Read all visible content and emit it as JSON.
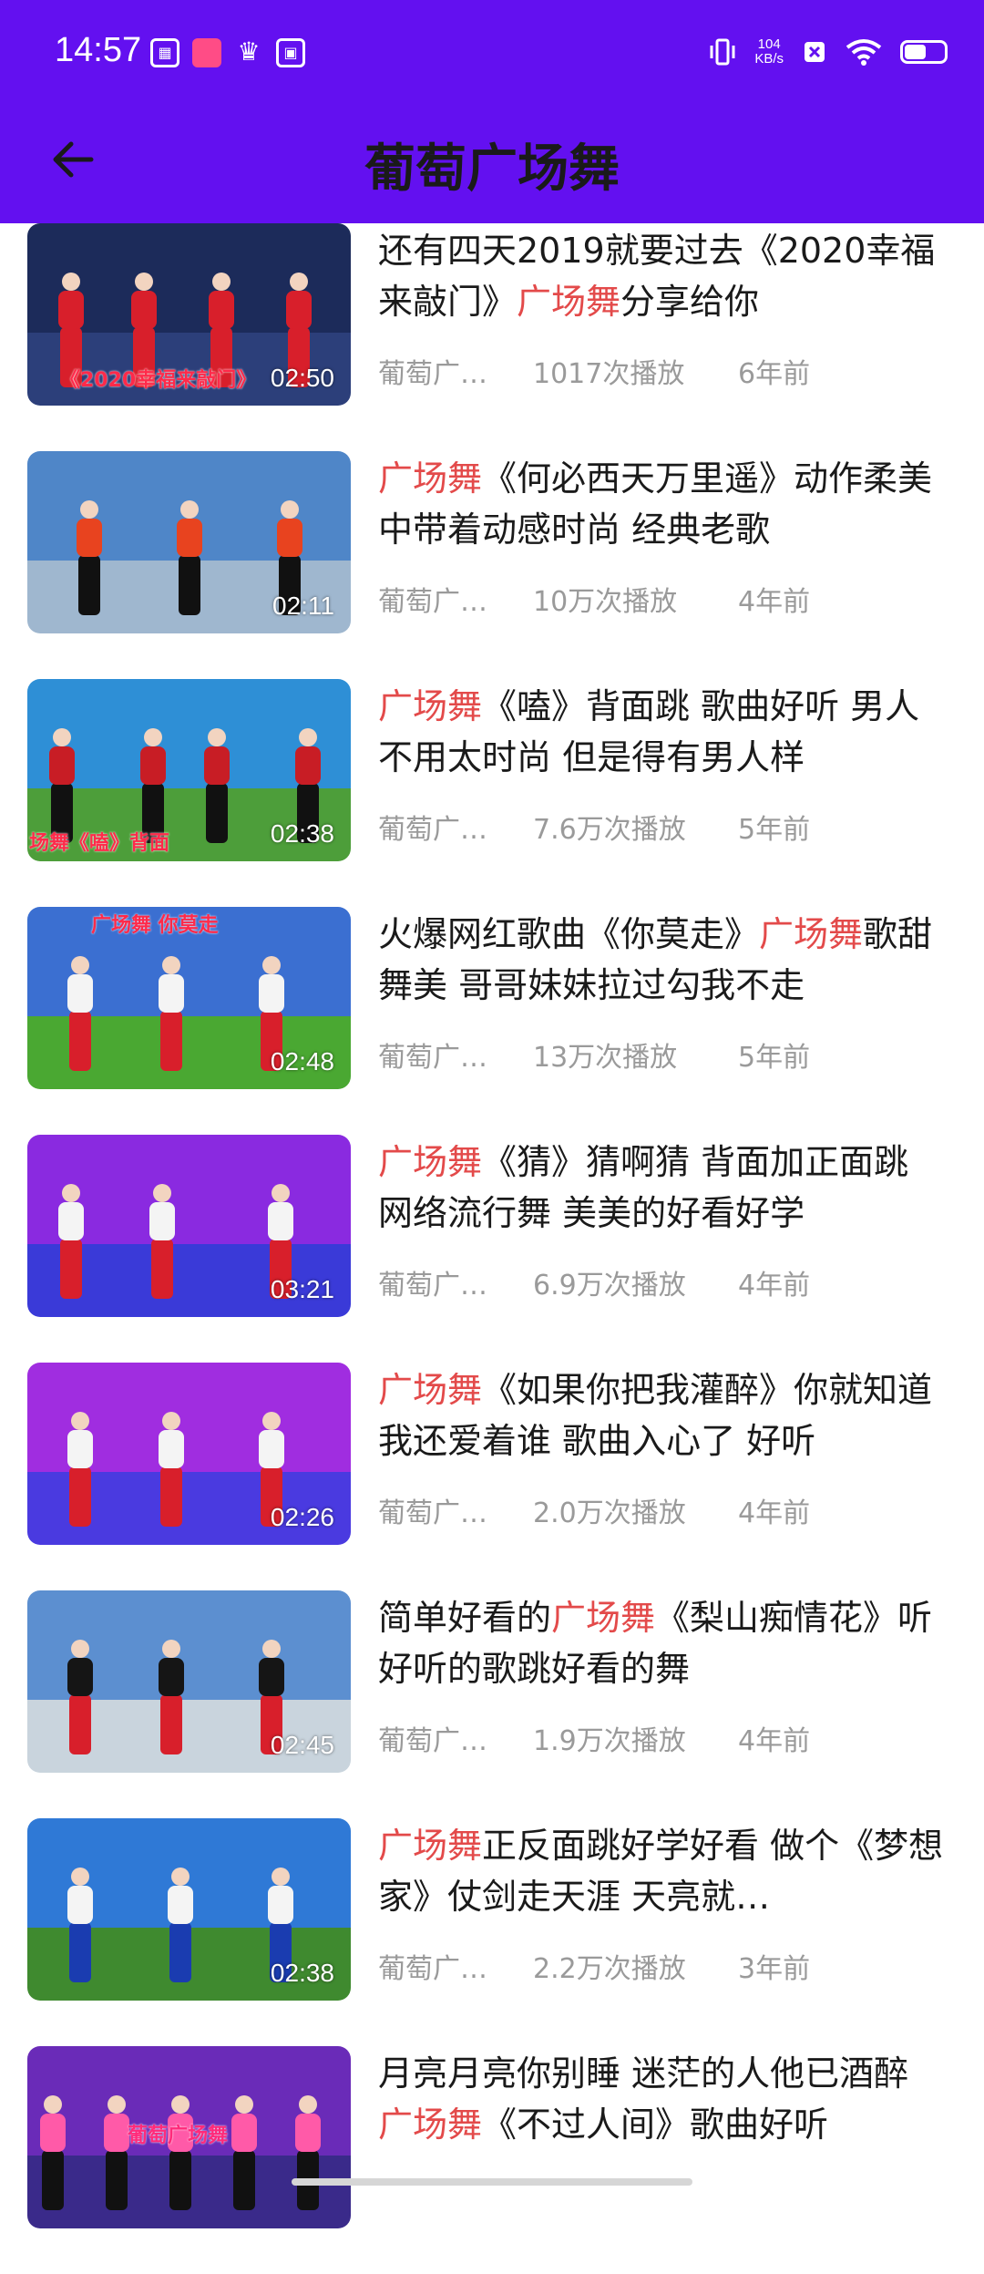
{
  "status": {
    "time": "14:57",
    "speed_value": "104",
    "speed_unit": "KB/s",
    "battery_fraction": 0.55,
    "left_icons": [
      "app-icon-1",
      "app-icon-2",
      "crown-icon",
      "app-icon-3"
    ]
  },
  "header": {
    "title": "葡萄广场舞",
    "back_icon": "arrow-left-icon"
  },
  "colors": {
    "header_bg": "#6310f0",
    "keyword": "#e34a4a"
  },
  "videos": [
    {
      "title_parts": [
        {
          "t": "还有四天2019就要过去《2020幸福来敲门》"
        },
        {
          "t": "广场舞",
          "kw": true
        },
        {
          "t": "分享给你"
        }
      ],
      "author": "葡萄广…",
      "plays": "1017次播放",
      "age": "6年前",
      "duration": "02:50",
      "overlay": "《2020幸福来敲门》",
      "theme": {
        "sky": "#1c2b5a",
        "ground": "#2c3f7a",
        "torso": "#d81f2b",
        "legs": "#d81f2b"
      }
    },
    {
      "title_parts": [
        {
          "t": "广场舞",
          "kw": true
        },
        {
          "t": "《何必西天万里遥》动作柔美中带着动感时尚 经典老歌"
        }
      ],
      "author": "葡萄广…",
      "plays": "10万次播放",
      "age": "4年前",
      "duration": "02:11",
      "overlay": "",
      "theme": {
        "sky": "#4f86c8",
        "ground": "#9fb7cf",
        "torso": "#e8431f",
        "legs": "#111111"
      }
    },
    {
      "title_parts": [
        {
          "t": "广场舞",
          "kw": true
        },
        {
          "t": "《嗑》背面跳 歌曲好听 男人不用太时尚 但是得有男人样"
        }
      ],
      "author": "葡萄广…",
      "plays": "7.6万次播放",
      "age": "5年前",
      "duration": "02:38",
      "overlay": "场舞《嗑》背面",
      "theme": {
        "sky": "#2e8fd6",
        "ground": "#4d9e3a",
        "torso": "#c81d25",
        "legs": "#111111"
      }
    },
    {
      "title_parts": [
        {
          "t": "火爆网红歌曲《你莫走》"
        },
        {
          "t": "广场舞",
          "kw": true
        },
        {
          "t": "歌甜舞美 哥哥妹妹拉过勾我不走"
        }
      ],
      "author": "葡萄广…",
      "plays": "13万次播放",
      "age": "5年前",
      "duration": "02:48",
      "overlay": "广场舞 你莫走",
      "theme": {
        "sky": "#3b6fd1",
        "ground": "#4aa832",
        "torso": "#f4f4f4",
        "legs": "#d81f2b"
      }
    },
    {
      "title_parts": [
        {
          "t": "广场舞",
          "kw": true
        },
        {
          "t": "《猜》猜啊猜 背面加正面跳 网络流行舞 美美的好看好学"
        }
      ],
      "author": "葡萄广…",
      "plays": "6.9万次播放",
      "age": "4年前",
      "duration": "03:21",
      "overlay": "",
      "theme": {
        "sky": "#8a2ae0",
        "ground": "#3a3ad8",
        "torso": "#f4f4f4",
        "legs": "#d81f2b"
      }
    },
    {
      "title_parts": [
        {
          "t": "广场舞",
          "kw": true
        },
        {
          "t": "《如果你把我灌醉》你就知道我还爱着谁 歌曲入心了 好听"
        }
      ],
      "author": "葡萄广…",
      "plays": "2.0万次播放",
      "age": "4年前",
      "duration": "02:26",
      "overlay": "",
      "theme": {
        "sky": "#a02de0",
        "ground": "#4a3ae0",
        "torso": "#f4f4f4",
        "legs": "#d81f2b"
      }
    },
    {
      "title_parts": [
        {
          "t": "简单好看的"
        },
        {
          "t": "广场舞",
          "kw": true
        },
        {
          "t": "《梨山痴情花》听好听的歌跳好看的舞"
        }
      ],
      "author": "葡萄广…",
      "plays": "1.9万次播放",
      "age": "4年前",
      "duration": "02:45",
      "overlay": "",
      "theme": {
        "sky": "#5c8fd0",
        "ground": "#c9d4dd",
        "torso": "#151515",
        "legs": "#d81f2b"
      }
    },
    {
      "title_parts": [
        {
          "t": "广场舞",
          "kw": true
        },
        {
          "t": "正反面跳好学好看 做个《梦想家》仗剑走天涯 天亮就…"
        }
      ],
      "author": "葡萄广…",
      "plays": "2.2万次播放",
      "age": "3年前",
      "duration": "02:38",
      "overlay": "",
      "theme": {
        "sky": "#2f79d6",
        "ground": "#3f8a2f",
        "torso": "#f4f4f4",
        "legs": "#1a3cb0"
      }
    },
    {
      "title_parts": [
        {
          "t": "月亮月亮你别睡 迷茫的人他已酒醉 "
        },
        {
          "t": "广场舞",
          "kw": true
        },
        {
          "t": "《不过人间》歌曲好听"
        }
      ],
      "author": "",
      "plays": "",
      "age": "",
      "duration": "",
      "overlay": "葡萄广场舞",
      "theme": {
        "sky": "#6a2bb8",
        "ground": "#3a2a8a",
        "torso": "#ff5aa8",
        "legs": "#111111"
      }
    }
  ]
}
